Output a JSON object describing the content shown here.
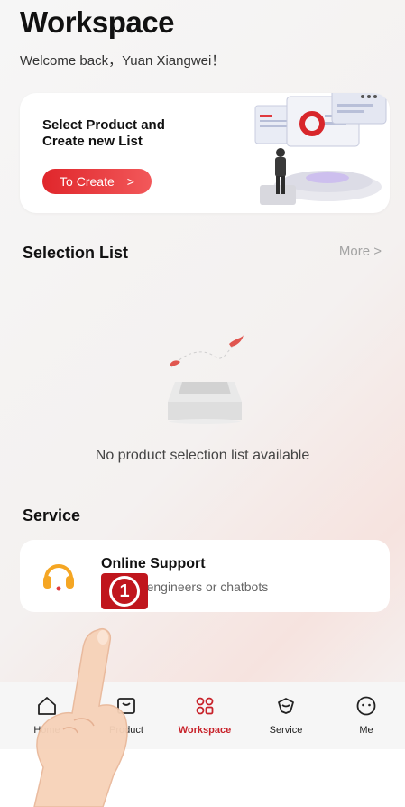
{
  "header": {
    "title": "Workspace",
    "welcome": "Welcome back，Yuan Xiangwei！"
  },
  "banner": {
    "headline": "Select Product and Create new List",
    "cta_label": "To Create",
    "cta_arrow": ">"
  },
  "selection": {
    "title": "Selection List",
    "more_label": "More >",
    "empty_message": "No product selection list available"
  },
  "service": {
    "title": "Service",
    "online_support": {
      "title": "Online Support",
      "description": "Huawei engineers or chatbots"
    }
  },
  "callout": {
    "step": "1"
  },
  "tabbar": {
    "items": [
      {
        "label": "Home",
        "icon": "home-icon",
        "active": false
      },
      {
        "label": "Product",
        "icon": "product-icon",
        "active": false
      },
      {
        "label": "Workspace",
        "icon": "workspace-icon",
        "active": true
      },
      {
        "label": "Service",
        "icon": "service-icon",
        "active": false
      },
      {
        "label": "Me",
        "icon": "me-icon",
        "active": false
      }
    ]
  },
  "colors": {
    "accent": "#c8222a",
    "cta_gradient_start": "#e0262b",
    "callout": "#c0161d",
    "support_icon": "#f5a623"
  }
}
